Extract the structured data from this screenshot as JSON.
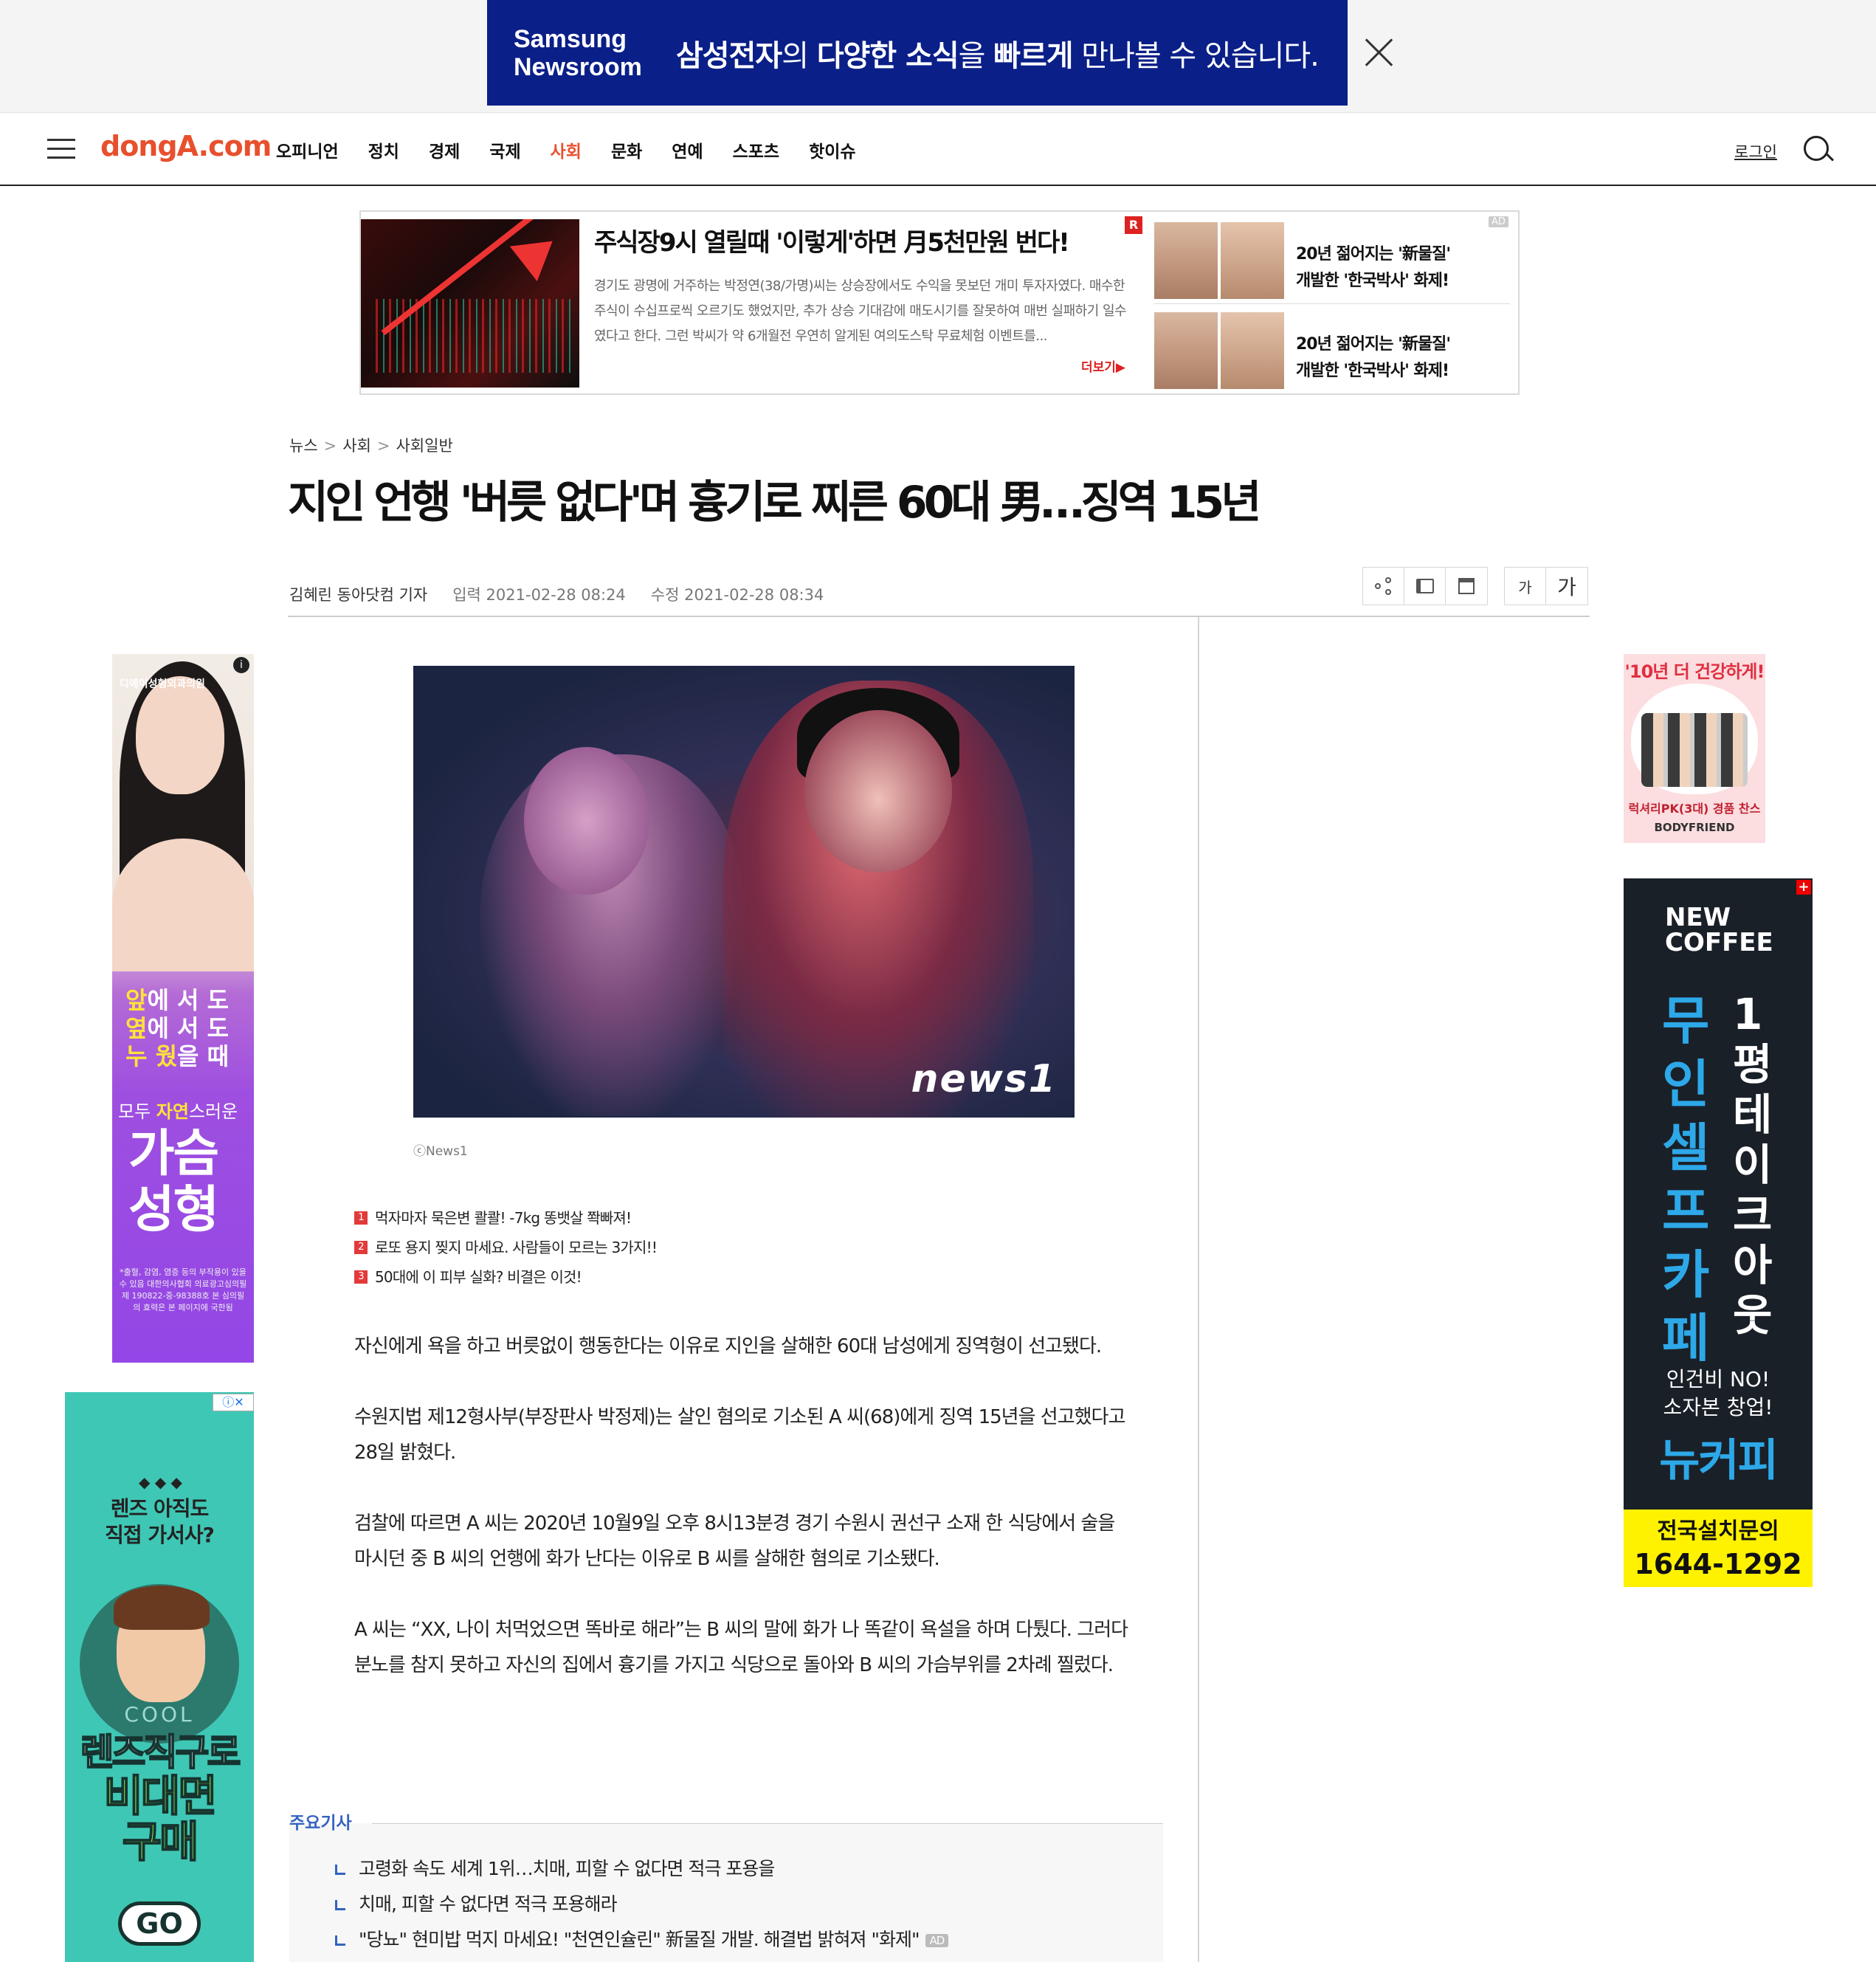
{
  "top_banner": {
    "brand_line1": "Samsung",
    "brand_line2": "Newsroom",
    "message_part1": "삼성전자",
    "message_part2": "의 ",
    "message_part3": "다양한 소식",
    "message_part4": "을 ",
    "message_part5": "빠르게",
    "message_part6": " 만나볼 수 있습니다."
  },
  "gnb": {
    "logo": "dongA.com",
    "menu": [
      "오피니언",
      "정치",
      "경제",
      "국제",
      "사회",
      "문화",
      "연예",
      "스포츠",
      "핫이슈"
    ],
    "active_menu": "사회",
    "login": "로그인"
  },
  "top_ad": {
    "title": "주식장9시 열릴때 '이렇게'하면 月5천만원 번다!",
    "body": "경기도 광명에 거주하는 박정연(38/가명)씨는 상승장에서도 수익을 못보던 개미 투자자였다. 매수한 주식이 수십프로씩 오르기도 했었지만, 추가 상승 기대감에 매도시기를 잘못하여 매번 실패하기 일수였다고 한다. 그런 박씨가 약 6개월전 우연히 알게된 여의도스탁 무료체험 이벤트를...",
    "more": "더보기▶",
    "r_badge": "R",
    "ad_tag": "AD",
    "side_items": [
      {
        "line1": "20년 젊어지는 '新물질'",
        "line2": "개발한 '한국박사' 화제!"
      },
      {
        "line1": "20년 젊어지는 '新물질'",
        "line2": "개발한 '한국박사' 화제!"
      }
    ]
  },
  "article": {
    "breadcrumb": [
      "뉴스",
      "사회",
      "사회일반"
    ],
    "headline": "지인 언행 '버릇 없다'며 흉기로 찌른 60대 男…징역 15년",
    "reporter": "김혜린 동아닷컴 기자",
    "input_date": "입력 2021-02-28 08:24",
    "edit_date": "수정 2021-02-28 08:34",
    "font_small": "가",
    "font_large": "가",
    "photo_mark": "news1",
    "caption": "ⓒNews1",
    "related": [
      {
        "num": "1",
        "text": "먹자마자 묵은변 콸콸! -7kg 똥뱃살 쫙빠져!"
      },
      {
        "num": "2",
        "text": "로또 용지 찢지 마세요. 사람들이 모르는 3가지!!"
      },
      {
        "num": "3",
        "text": "50대에 이 피부 실화? 비결은 이것!"
      }
    ],
    "paragraphs": [
      "자신에게 욕을 하고 버릇없이 행동한다는 이유로 지인을 살해한 60대 남성에게 징역형이 선고됐다.",
      "수원지법 제12형사부(부장판사 박정제)는 살인 혐의로 기소된 A 씨(68)에게 징역 15년을 선고했다고 28일 밝혔다.",
      "검찰에 따르면 A 씨는 2020년 10월9일 오후 8시13분경 경기 수원시 권선구 소재 한 식당에서 술을 마시던 중 B 씨의 언행에 화가 난다는 이유로 B 씨를 살해한 혐의로 기소됐다.",
      "A 씨는 “XX, 나이 처먹었으면 똑바로 해라”는 B 씨의 말에 화가 나 똑같이 욕설을 하며 다퉜다. 그러다 분노를 참지 못하고 자신의 집에서 흉기를 가지고 식당으로 돌아와 B 씨의 가슴부위를 2차례 찔렀다."
    ]
  },
  "key_news": {
    "title": "주요기사",
    "items": [
      "고령화 속도 세계 1위…치매, 피할 수 없다면 적극 포용을",
      "치매, 피할 수 없다면 적극 포용해라",
      "\"당뇨\" 현미밥 먹지 마세요! \"천연인슐린\" 新물질 개발. 해결법 밝혀져 \"화제\""
    ],
    "ad_chip": "AD"
  },
  "side_ads": {
    "left1": {
      "logo": "디에이성형외과의원",
      "lines": [
        [
          "앞",
          "에 서 도"
        ],
        [
          "옆",
          "에 서 도"
        ],
        [
          "누 웠",
          "을 때"
        ]
      ],
      "sub_pre": "모두 ",
      "sub_em": "자연",
      "sub_post": "스러운",
      "big1": "가슴",
      "big2": "성형",
      "fine": "*출혈, 감염, 염증 등의 부작용이 있을 수 있음 대한의사협회 의료광고심의필 제 190822-중-98388호 본 심의필의 효력은 본 페이지에 국한됨"
    },
    "left2": {
      "q1": "렌즈 아직도",
      "q2": "직접 가서사?",
      "cool": "COOL",
      "cta1": "렌즈직구로",
      "cta2a": "비대면",
      "cta2b": "구매",
      "go": "GO"
    },
    "right1": {
      "headline": "'10년 더 건강하게!",
      "product": "럭셔리PK(3대) 경품 찬스",
      "brand": "BODYFRIEND"
    },
    "right2": {
      "brand1": "NEW",
      "brand2": "COFFEE",
      "vertical1": "무인셀프카페",
      "vertical2": "1평테이크아웃",
      "copy1": "인건비 NO!",
      "copy2": "소자본 창업!",
      "name": "뉴커피",
      "foot1": "전국설치문의",
      "foot2": "1644-1292"
    }
  }
}
